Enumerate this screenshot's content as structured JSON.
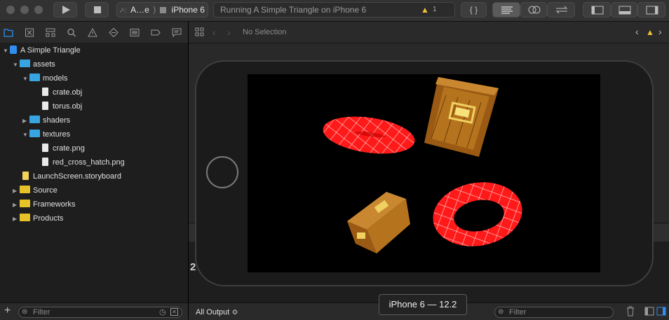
{
  "toolbar": {
    "scheme": "A…e",
    "scheme_separator": "⟩",
    "device": "iPhone 6",
    "activity": "Running A Simple Triangle on iPhone 6",
    "warning_count": "1",
    "warning_color": "#f2c037"
  },
  "navigator": {
    "project": "A Simple Triangle",
    "items": [
      {
        "label": "assets"
      },
      {
        "label": "models"
      },
      {
        "label": "crate.obj"
      },
      {
        "label": "torus.obj"
      },
      {
        "label": "shaders"
      },
      {
        "label": "textures"
      },
      {
        "label": "crate.png"
      },
      {
        "label": "red_cross_hatch.png"
      },
      {
        "label": "LaunchScreen.storyboard"
      },
      {
        "label": "Source"
      },
      {
        "label": "Frameworks"
      },
      {
        "label": "Products"
      }
    ],
    "filter_placeholder": "Filter",
    "add_glyph": "+"
  },
  "editor": {
    "jump_label": "No Selection"
  },
  "debug": {
    "partial_text": "2",
    "output_selector": "All Output ≎",
    "filter_placeholder": "Filter"
  },
  "simulator": {
    "label": "iPhone 6 — 12.2"
  },
  "colors": {
    "accent": "#2f8ef0",
    "folder_blue": "#38a5e0",
    "folder_yellow": "#e6c229",
    "torus_red": "#ff1a1a",
    "crate_wood": "#b5731d"
  }
}
